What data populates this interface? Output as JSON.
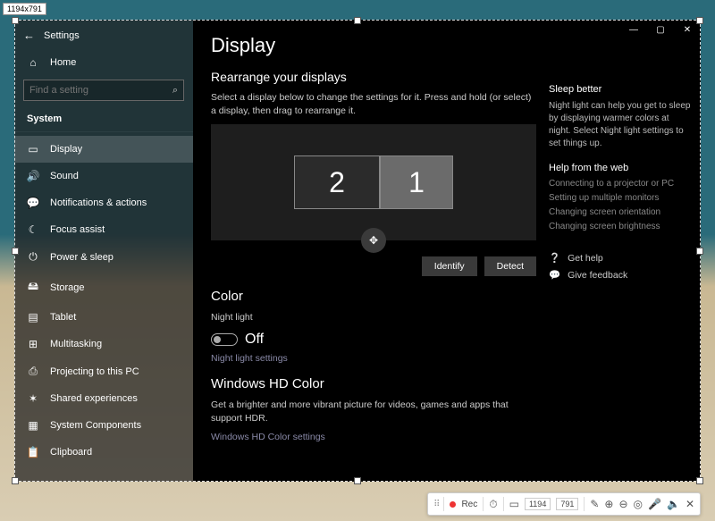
{
  "dim_badge": "1194x791",
  "window": {
    "app_title": "Settings",
    "home_label": "Home",
    "search_placeholder": "Find a setting",
    "category": "System",
    "nav": [
      {
        "icon": "▭",
        "label": "Display",
        "active": true
      },
      {
        "icon": "🔊",
        "label": "Sound"
      },
      {
        "icon": "💬",
        "label": "Notifications & actions"
      },
      {
        "icon": "☾",
        "label": "Focus assist"
      },
      {
        "icon": "⏻",
        "label": "Power & sleep"
      },
      {
        "icon": "🖴",
        "label": "Storage"
      },
      {
        "icon": "▤",
        "label": "Tablet"
      },
      {
        "icon": "⊞",
        "label": "Multitasking"
      },
      {
        "icon": "⎙",
        "label": "Projecting to this PC"
      },
      {
        "icon": "✶",
        "label": "Shared experiences"
      },
      {
        "icon": "▦",
        "label": "System Components"
      },
      {
        "icon": "📋",
        "label": "Clipboard"
      }
    ]
  },
  "page": {
    "title": "Display",
    "rearrange_title": "Rearrange your displays",
    "rearrange_desc": "Select a display below to change the settings for it. Press and hold (or select) a display, then drag to rearrange it.",
    "displays": {
      "d2": "2",
      "d1": "1"
    },
    "identify_btn": "Identify",
    "detect_btn": "Detect",
    "color_title": "Color",
    "night_light_label": "Night light",
    "night_light_state": "Off",
    "night_light_link": "Night light settings",
    "hd_title": "Windows HD Color",
    "hd_desc": "Get a brighter and more vibrant picture for videos, games and apps that support HDR.",
    "hd_link": "Windows HD Color settings"
  },
  "aside": {
    "sleep_title": "Sleep better",
    "sleep_desc": "Night light can help you get to sleep by displaying warmer colors at night. Select Night light settings to set things up.",
    "help_title": "Help from the web",
    "help_links": [
      "Connecting to a projector or PC",
      "Setting up multiple monitors",
      "Changing screen orientation",
      "Changing screen brightness"
    ],
    "get_help": "Get help",
    "give_feedback": "Give feedback"
  },
  "toolbar": {
    "rec": "Rec",
    "w": "1194",
    "h": "791"
  }
}
